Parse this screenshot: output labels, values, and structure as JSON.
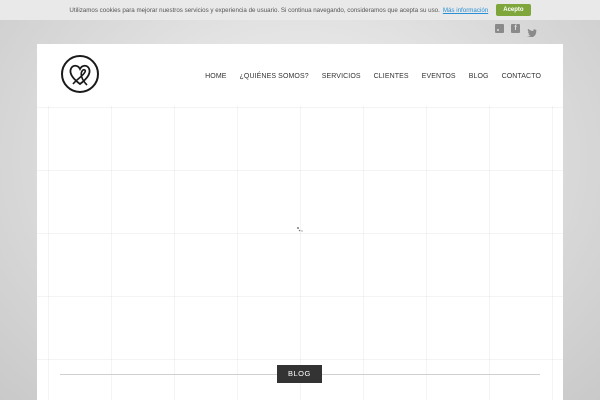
{
  "cookie_bar": {
    "text": "Utilizamos cookies para mejorar nuestros servicios y experiencia de usuario. Si continua navegando, consideramos que acepta su uso.",
    "more_link": "Más información",
    "accept_label": "Acepto",
    "accent_color": "#7ea63a"
  },
  "social": {
    "icons": [
      "rss-icon",
      "facebook-icon",
      "twitter-icon"
    ],
    "facebook_glyph": "f"
  },
  "nav": {
    "items": [
      "HOME",
      "¿QUIÉNES SOMOS?",
      "SERVICIOS",
      "CLIENTES",
      "EVENTOS",
      "BLOG",
      "CONTACTO"
    ]
  },
  "logo": {
    "icon": "heart-circle-logo"
  },
  "section": {
    "title": "BLOG"
  }
}
